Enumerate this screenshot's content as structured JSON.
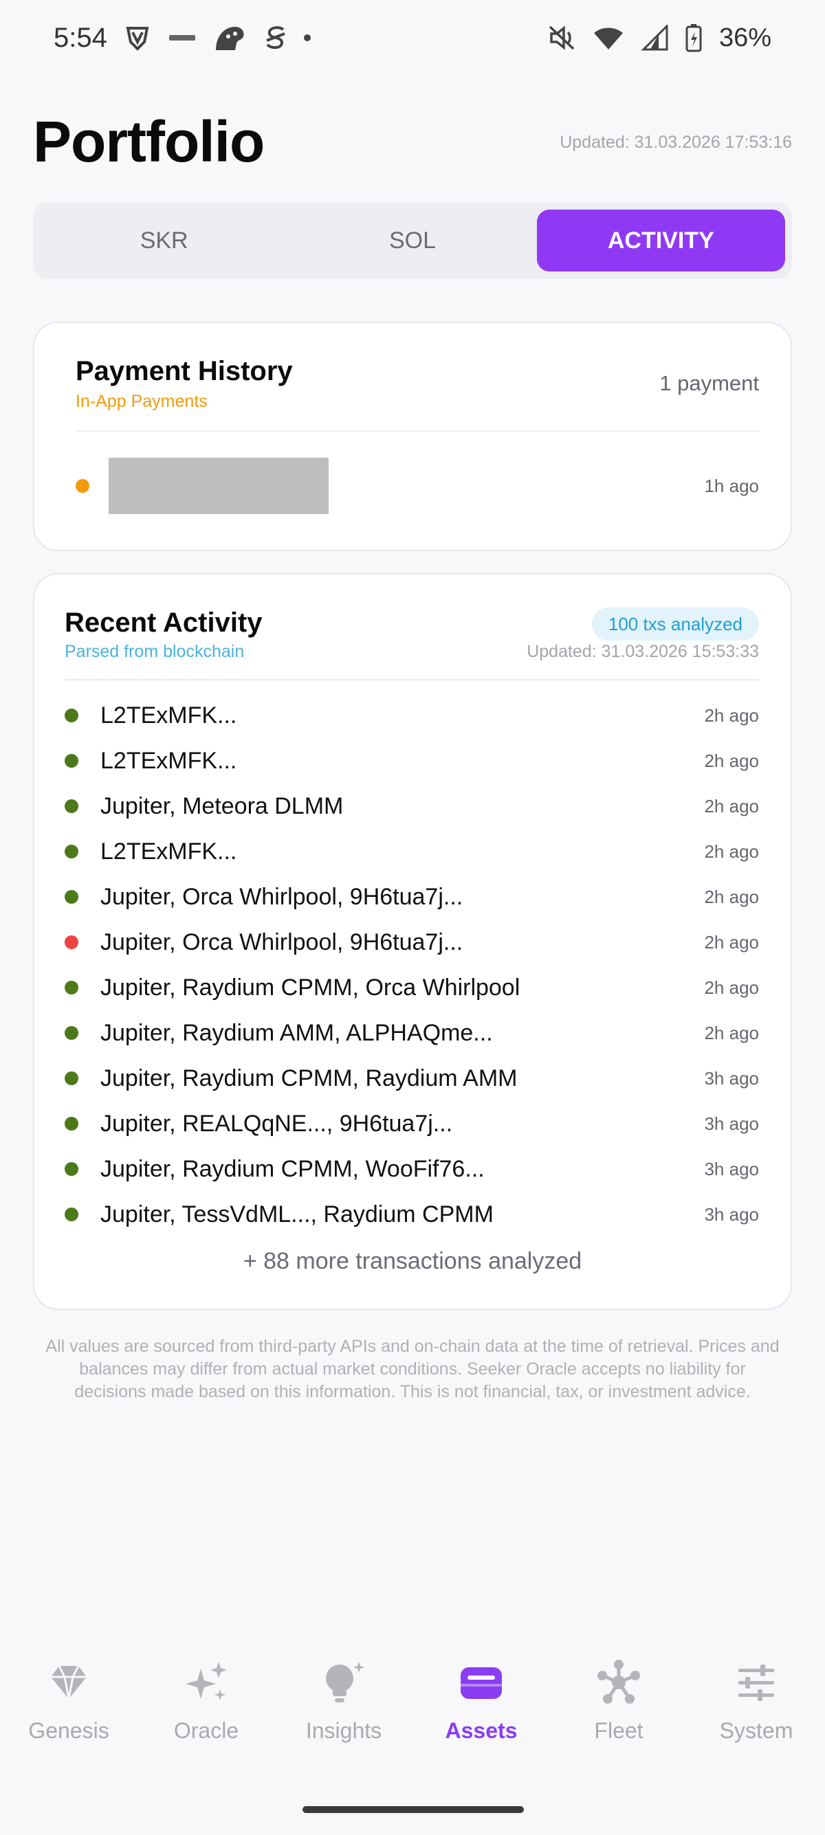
{
  "status_bar": {
    "time": "5:54",
    "battery_percent": "36%",
    "left_icons": [
      "shield-v-icon",
      "mobile-brand-icon",
      "dino-icon",
      "strike-s-icon",
      "notification-dot-icon"
    ],
    "right_icons": [
      "mute-icon",
      "wifi-icon",
      "signal-icon",
      "battery-icon"
    ]
  },
  "header": {
    "title": "Portfolio",
    "updated": "Updated: 31.03.2026 17:53:16"
  },
  "tabs": [
    {
      "label": "SKR",
      "active": false
    },
    {
      "label": "SOL",
      "active": false
    },
    {
      "label": "ACTIVITY",
      "active": true
    }
  ],
  "payment_history": {
    "title": "Payment History",
    "subtitle": "In-App Payments",
    "count": "1 payment",
    "items": [
      {
        "time": "1h ago",
        "dot_color": "#f29b0e"
      }
    ]
  },
  "recent_activity": {
    "title": "Recent Activity",
    "subtitle": "Parsed from blockchain",
    "badge": "100 txs analyzed",
    "updated": "Updated: 31.03.2026 15:53:33",
    "items": [
      {
        "label": "L2TExMFK...",
        "time": "2h ago",
        "status": "success"
      },
      {
        "label": "L2TExMFK...",
        "time": "2h ago",
        "status": "success"
      },
      {
        "label": "Jupiter, Meteora DLMM",
        "time": "2h ago",
        "status": "success"
      },
      {
        "label": "L2TExMFK...",
        "time": "2h ago",
        "status": "success"
      },
      {
        "label": "Jupiter, Orca Whirlpool, 9H6tua7j...",
        "time": "2h ago",
        "status": "success"
      },
      {
        "label": "Jupiter, Orca Whirlpool, 9H6tua7j...",
        "time": "2h ago",
        "status": "failed"
      },
      {
        "label": "Jupiter, Raydium CPMM, Orca Whirlpool",
        "time": "2h ago",
        "status": "success"
      },
      {
        "label": "Jupiter, Raydium AMM, ALPHAQme...",
        "time": "2h ago",
        "status": "success"
      },
      {
        "label": "Jupiter, Raydium CPMM, Raydium AMM",
        "time": "3h ago",
        "status": "success"
      },
      {
        "label": "Jupiter, REALQqNE..., 9H6tua7j...",
        "time": "3h ago",
        "status": "success"
      },
      {
        "label": "Jupiter, Raydium CPMM, WooFif76...",
        "time": "3h ago",
        "status": "success"
      },
      {
        "label": "Jupiter, TessVdML..., Raydium CPMM",
        "time": "3h ago",
        "status": "success"
      }
    ],
    "more": "+ 88 more transactions analyzed"
  },
  "disclaimer": "All values are sourced from third-party APIs and on-chain data at the time of retrieval. Prices and balances may differ from actual market conditions. Seeker Oracle accepts no liability for decisions made based on this information. This is not financial, tax, or investment advice.",
  "bottom_nav": [
    {
      "label": "Genesis",
      "icon": "gem-icon",
      "active": false
    },
    {
      "label": "Oracle",
      "icon": "sparkles-icon",
      "active": false
    },
    {
      "label": "Insights",
      "icon": "lightbulb-icon",
      "active": false
    },
    {
      "label": "Assets",
      "icon": "wallet-icon",
      "active": true
    },
    {
      "label": "Fleet",
      "icon": "network-icon",
      "active": false
    },
    {
      "label": "System",
      "icon": "sliders-icon",
      "active": false
    }
  ],
  "colors": {
    "accent": "#9039f5",
    "success_dot": "#4c7a1a",
    "failed_dot": "#ee4444",
    "payment_dot": "#f29b0e"
  }
}
